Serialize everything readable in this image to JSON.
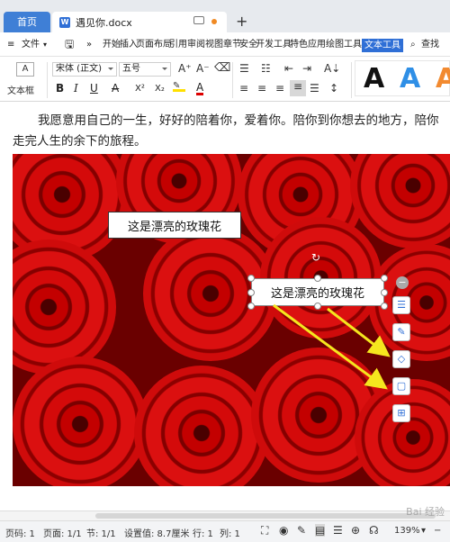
{
  "tabs": {
    "home": "首页",
    "doc_badge": "W",
    "doc_title": "遇见你.docx",
    "new_tab": "+"
  },
  "menu": {
    "file": "文件",
    "items": [
      "开始",
      "插入",
      "页面布局",
      "引用",
      "审阅",
      "视图",
      "章节",
      "安全",
      "开发工具",
      "特色应用",
      "绘图工具"
    ],
    "active": "文本工具",
    "search": "查找"
  },
  "ribbon": {
    "textbox_label": "文本框",
    "font_name": "宋体 (正文)",
    "font_size": "五号",
    "bold": "B",
    "italic": "I",
    "underline": "U",
    "strike": "A",
    "superscript": "X²",
    "subscript": "X₂",
    "grow": "A⁺",
    "shrink": "A⁻",
    "style_samples": [
      "A",
      "A",
      "A"
    ],
    "style_colors": [
      "#111111",
      "#2f8fe6",
      "#f28a30"
    ]
  },
  "document": {
    "paragraph": "我愿意用自己的一生，好好的陪着你，爱着你。陪你到你想去的地方，陪你走完人生的余下的旅程。",
    "textbox1": "这是漂亮的玫瑰花",
    "textbox2": "这是漂亮的玫瑰花",
    "arrow_color": "#f5e61e"
  },
  "status": {
    "page_no": "页码: 1",
    "pages": "页面: 1/1",
    "section": "节: 1/1",
    "setting": "设置值: 8.7厘米",
    "row": "行: 1",
    "col": "列: 1",
    "zoom": "139%"
  },
  "watermark": "Bai 经验"
}
